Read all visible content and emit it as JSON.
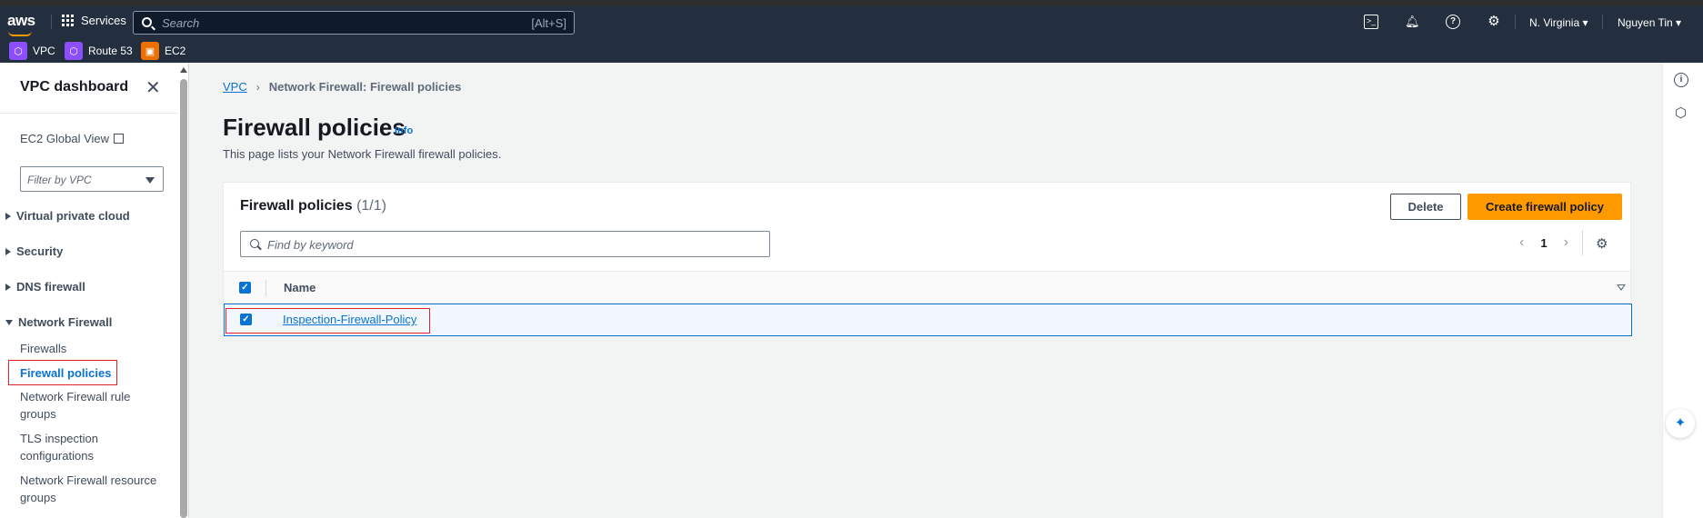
{
  "topnav": {
    "logo": "aws",
    "services_label": "Services",
    "search_placeholder": "Search",
    "search_shortcut": "[Alt+S]",
    "region": "N. Virginia ▾",
    "user": "Nguyen Tin ▾",
    "favorites": [
      {
        "label": "VPC",
        "color": "#8c4fff"
      },
      {
        "label": "Route 53",
        "color": "#8c4fff"
      },
      {
        "label": "EC2",
        "color": "#ed7100"
      }
    ]
  },
  "sidebar": {
    "title": "VPC dashboard",
    "close_glyph": "✕",
    "global_view": "EC2 Global View",
    "filter_placeholder": "Filter by VPC",
    "sections": [
      {
        "label": "Virtual private cloud",
        "expanded": false
      },
      {
        "label": "Security",
        "expanded": false
      },
      {
        "label": "DNS firewall",
        "expanded": false
      },
      {
        "label": "Network Firewall",
        "expanded": true
      }
    ],
    "network_firewall_items": [
      {
        "label": "Firewalls",
        "active": false
      },
      {
        "label": "Firewall policies",
        "active": true
      },
      {
        "label": "Network Firewall rule groups",
        "active": false
      },
      {
        "label": "TLS inspection configurations",
        "active": false
      },
      {
        "label": "Network Firewall resource groups",
        "active": false
      }
    ]
  },
  "breadcrumb": {
    "root": "VPC",
    "separator": "›",
    "current": "Network Firewall: Firewall policies"
  },
  "page": {
    "title": "Firewall policies",
    "info": "Info",
    "description": "This page lists your Network Firewall firewall policies."
  },
  "table": {
    "title": "Firewall policies",
    "count": "(1/1)",
    "delete_label": "Delete",
    "create_label": "Create firewall policy",
    "search_placeholder": "Find by keyword",
    "page_number": "1",
    "prev_glyph": "‹",
    "next_glyph": "›",
    "column_name": "Name",
    "rows": [
      {
        "name": "Inspection-Firewall-Policy",
        "selected": true
      }
    ]
  },
  "colors": {
    "nav_bg": "#232f3e",
    "accent_orange": "#ff9900",
    "link_blue": "#0972d3",
    "highlight_red": "#e02424"
  }
}
